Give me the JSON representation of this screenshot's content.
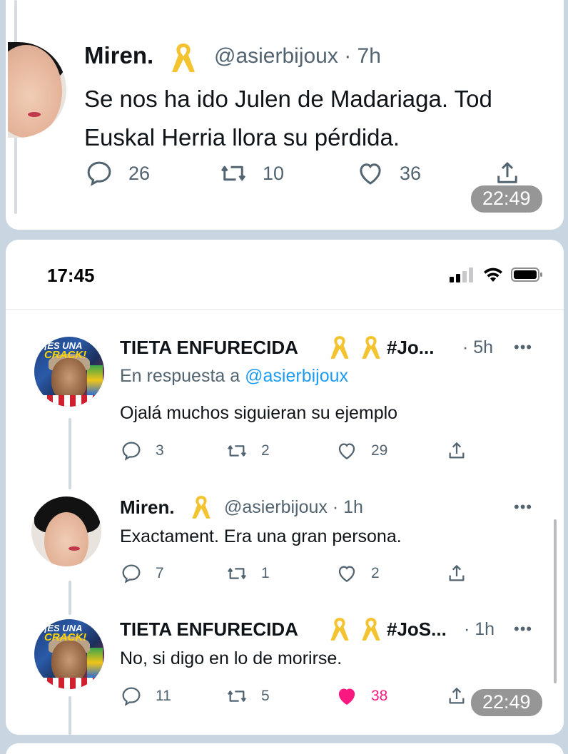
{
  "colors": {
    "background": "#c9d6e2",
    "ribbon": "#f4c430",
    "link": "#1d9bf0",
    "muted": "#536471",
    "like_active": "#f91880"
  },
  "top_card": {
    "tweet": {
      "name": "Miren.",
      "handle_time": "@asierbijoux · 7h",
      "text_line1": "Se nos ha ido Julen de Madariaga. Tod",
      "text_line2": "Euskal Herria llora su pérdida.",
      "replies": "26",
      "retweets": "10",
      "likes": "36"
    },
    "timestamp": "22:49"
  },
  "phone_card": {
    "status_bar": {
      "time": "17:45",
      "icons": [
        "signal-icon",
        "wifi-icon",
        "battery-icon"
      ]
    },
    "tweets": [
      {
        "name": "TIETA ENFURECIDA",
        "name_suffix": "#Jo...",
        "time": "· 5h",
        "more": "•••",
        "reply_prefix": "En respuesta a",
        "reply_handle": "@asierbijoux",
        "text": "Ojalá muchos siguieran su ejemplo",
        "avatar_text_top": "¡ES UNA",
        "avatar_text_bottom": "CRACK!",
        "replies": "3",
        "retweets": "2",
        "likes": "29"
      },
      {
        "name": "Miren.",
        "handle_time": "@asierbijoux · 1h",
        "more": "•••",
        "text": "Exactament. Era una gran persona.",
        "replies": "7",
        "retweets": "1",
        "likes": "2"
      },
      {
        "name": "TIETA ENFURECIDA",
        "name_suffix": "#JoS...",
        "time": "· 1h",
        "more": "•••",
        "text": "No, si digo en lo de morirse.",
        "avatar_text_top": "¡ES UNA",
        "avatar_text_bottom": "CRACK!",
        "replies": "11",
        "retweets": "5",
        "likes": "38",
        "liked": true
      }
    ],
    "timestamp": "22:49"
  }
}
